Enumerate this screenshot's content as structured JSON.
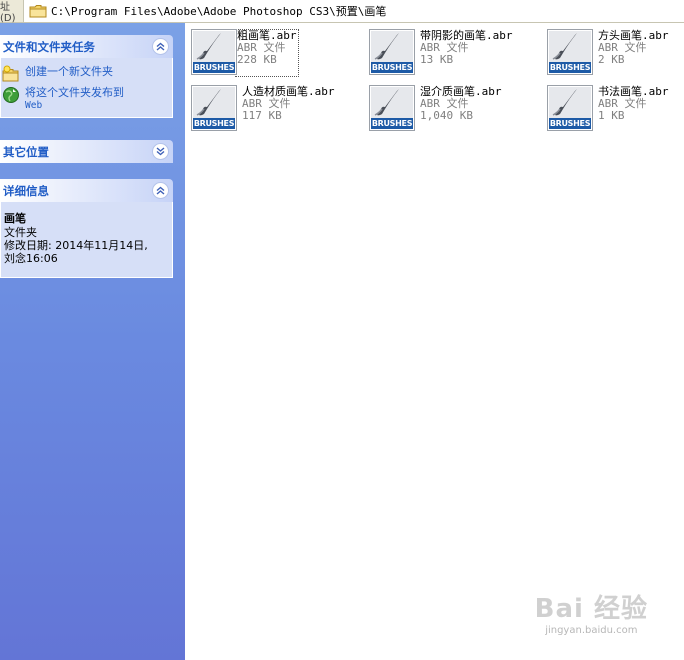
{
  "address": {
    "label": "址(D)",
    "path": "C:\\Program Files\\Adobe\\Adobe Photoshop CS3\\预置\\画笔"
  },
  "tasks_panel": {
    "title": "文件和文件夹任务",
    "items": [
      {
        "line1": "创建一个新文件夹",
        "line2": ""
      },
      {
        "line1": "将这个文件夹发布到",
        "line2": "Web"
      }
    ]
  },
  "other_places_panel": {
    "title": "其它位置"
  },
  "details_panel": {
    "title": "详细信息",
    "name": "画笔",
    "type": "文件夹",
    "modified_line1": "修改日期: 2014年11月14日,",
    "modified_line2": "刘念16:06"
  },
  "files": [
    {
      "name": "粗画笔.abr",
      "type": "ABR 文件",
      "size": "228 KB",
      "icon_label": "BRUSHES"
    },
    {
      "name": "带阴影的画笔.abr",
      "type": "ABR 文件",
      "size": "13 KB",
      "icon_label": "BRUSHES"
    },
    {
      "name": "方头画笔.abr",
      "type": "ABR 文件",
      "size": "2 KB",
      "icon_label": "BRUSHES"
    },
    {
      "name": "人造材质画笔.abr",
      "type": "ABR 文件",
      "size": "117 KB",
      "icon_label": "BRUSHES"
    },
    {
      "name": "湿介质画笔.abr",
      "type": "ABR 文件",
      "size": "1,040 KB",
      "icon_label": "BRUSHES"
    },
    {
      "name": "书法画笔.abr",
      "type": "ABR 文件",
      "size": "1 KB",
      "icon_label": "BRUSHES"
    }
  ],
  "watermark": {
    "big": "Bai 经验",
    "small": "jingyan.baidu.com"
  },
  "colors": {
    "taskpane_top": "#7ba1e6",
    "taskpane_bottom": "#6375d6",
    "panel_title": "#215dc6",
    "icon_label_bg": "#1d5aa6"
  }
}
